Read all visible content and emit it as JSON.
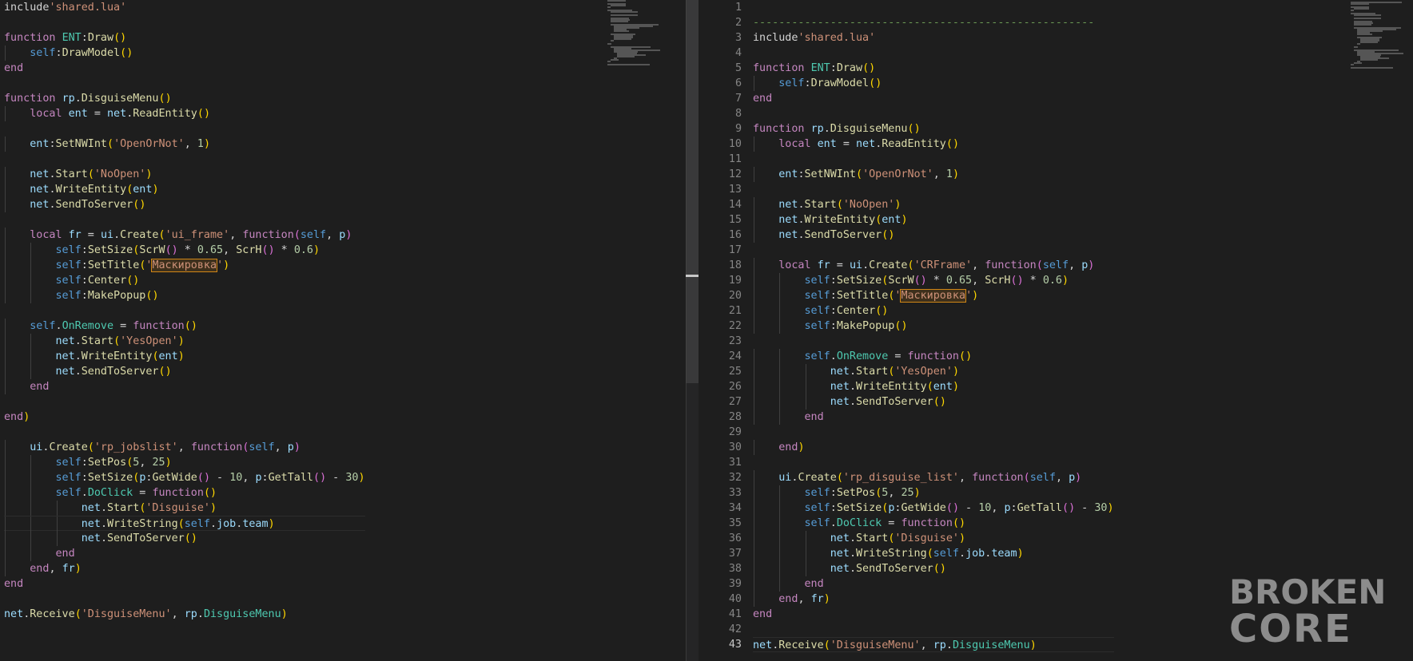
{
  "watermark": {
    "line1": "BROKEN",
    "line2": "CORE"
  },
  "colors": {
    "background": "#1e1e1e",
    "keyword": "#c586c0",
    "string": "#ce9178",
    "number": "#b5cea8",
    "function": "#dcdcaa",
    "variable": "#9cdcfe",
    "class": "#4ec9b0",
    "highlight": "#d18616"
  },
  "left_editor": {
    "lines": [
      "include'shared.lua'",
      "",
      "function ENT:Draw()",
      "    self:DrawModel()",
      "end",
      "",
      "function rp.DisguiseMenu()",
      "    local ent = net.ReadEntity()",
      "",
      "    ent:SetNWInt('OpenOrNot', 1)",
      "",
      "    net.Start('NoOpen')",
      "    net.WriteEntity(ent)",
      "    net.SendToServer()",
      "",
      "    local fr = ui.Create('ui_frame', function(self, p)",
      "        self:SetSize(ScrW() * 0.65, ScrH() * 0.6)",
      "        self:SetTitle('Маскировка')",
      "        self:Center()",
      "        self:MakePopup()",
      "",
      "    self.OnRemove = function()",
      "        net.Start('YesOpen')",
      "        net.WriteEntity(ent)",
      "        net.SendToServer()",
      "    end",
      "",
      "end)",
      "",
      "    ui.Create('rp_jobslist', function(self, p)",
      "        self:SetPos(5, 25)",
      "        self:SetSize(p:GetWide() - 10, p:GetTall() - 30)",
      "        self.DoClick = function()",
      "            net.Start('Disguise')",
      "            net.WriteString(self.job.team)",
      "            net.SendToServer()",
      "        end",
      "    end, fr)",
      "end",
      "",
      "net.Receive('DisguiseMenu', rp.DisguiseMenu)"
    ]
  },
  "right_editor": {
    "line_numbers": [
      "1",
      "2",
      "3",
      "4",
      "5",
      "6",
      "7",
      "8",
      "9",
      "10",
      "11",
      "12",
      "13",
      "14",
      "15",
      "16",
      "17",
      "18",
      "19",
      "20",
      "21",
      "22",
      "23",
      "24",
      "25",
      "26",
      "27",
      "28",
      "29",
      "30",
      "31",
      "32",
      "33",
      "34",
      "35",
      "36",
      "37",
      "38",
      "39",
      "40",
      "41",
      "42",
      "43"
    ],
    "active_line": "43",
    "lines": [
      "",
      "-----------------------------------------------------",
      "include'shared.lua'",
      "",
      "function ENT:Draw()",
      "    self:DrawModel()",
      "end",
      "",
      "function rp.DisguiseMenu()",
      "    local ent = net.ReadEntity()",
      "",
      "    ent:SetNWInt('OpenOrNot', 1)",
      "",
      "    net.Start('NoOpen')",
      "    net.WriteEntity(ent)",
      "    net.SendToServer()",
      "",
      "    local fr = ui.Create('CRFrame', function(self, p)",
      "        self:SetSize(ScrW() * 0.65, ScrH() * 0.6)",
      "        self:SetTitle('Маскировка')",
      "        self:Center()",
      "        self:MakePopup()",
      "",
      "        self.OnRemove = function()",
      "            net.Start('YesOpen')",
      "            net.WriteEntity(ent)",
      "            net.SendToServer()",
      "        end",
      "",
      "    end)",
      "",
      "    ui.Create('rp_disguise_list', function(self, p)",
      "        self:SetPos(5, 25)",
      "        self:SetSize(p:GetWide() - 10, p:GetTall() - 30)",
      "        self.DoClick = function()",
      "            net.Start('Disguise')",
      "            net.WriteString(self.job.team)",
      "            net.SendToServer()",
      "        end",
      "    end, fr)",
      "end",
      "",
      "net.Receive('DisguiseMenu', rp.DisguiseMenu)"
    ]
  }
}
